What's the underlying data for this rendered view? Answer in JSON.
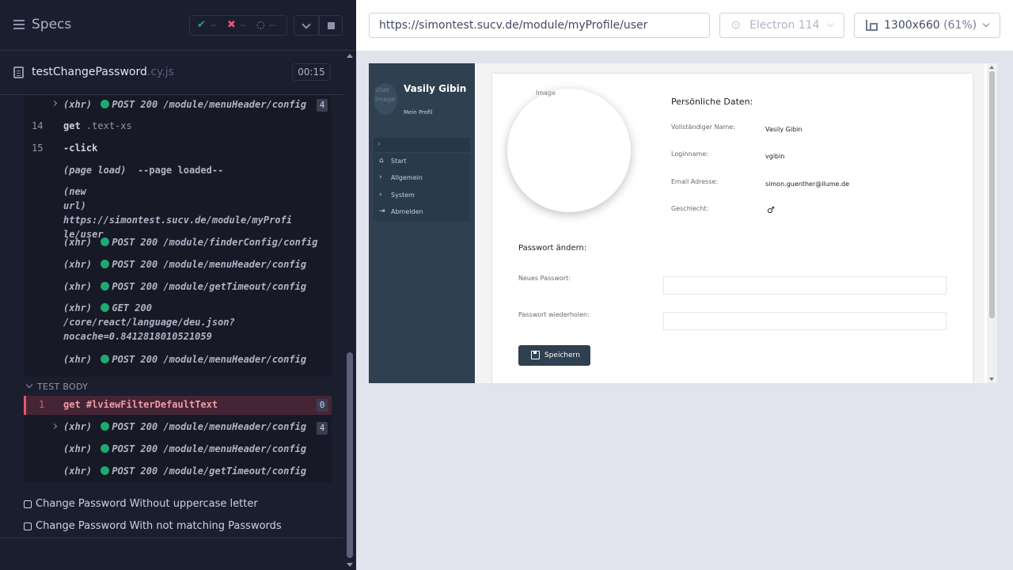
{
  "reporter": {
    "title": "Specs",
    "stats": {
      "passed": "--",
      "failed": "--",
      "pending": "--"
    },
    "file": {
      "name": "testChangePassword",
      "ext": ".cy.js",
      "duration": "00:15"
    },
    "commands": [
      {
        "type": "xhr",
        "label": "(xhr)",
        "method": "POST",
        "status": "200",
        "url": "/module/menuHeader/config",
        "count": "4"
      },
      {
        "num": "14",
        "name": "get",
        "arg": ".text-xs"
      },
      {
        "num": "15",
        "name": "-click"
      },
      {
        "label": "(page load)",
        "arg": "--page loaded--"
      },
      {
        "label": "(new url)",
        "lines": [
          "https://simontest.sucv.de/module/myProfi",
          "le/user"
        ]
      },
      {
        "type": "xhr",
        "label": "(xhr)",
        "method": "POST",
        "status": "200",
        "url": "/module/finderConfig/config"
      },
      {
        "type": "xhr",
        "label": "(xhr)",
        "method": "POST",
        "status": "200",
        "url": "/module/menuHeader/config"
      },
      {
        "type": "xhr",
        "label": "(xhr)",
        "method": "POST",
        "status": "200",
        "url": "/module/getTimeout/config"
      },
      {
        "type": "xhr",
        "label": "(xhr)",
        "method": "GET",
        "status": "200",
        "lines": [
          "/core/react/language/deu.json?",
          "nocache=0.8412818010521059"
        ]
      },
      {
        "type": "xhr",
        "label": "(xhr)",
        "method": "POST",
        "status": "200",
        "url": "/module/menuHeader/config"
      }
    ],
    "test_body_label": "TEST BODY",
    "failed_command": {
      "num": "1",
      "name": "get",
      "arg": "#lviewFilterDefaultText",
      "count": "0"
    },
    "body_commands": [
      {
        "label": "(xhr)",
        "method": "POST",
        "status": "200",
        "url": "/module/menuHeader/config",
        "count": "4"
      },
      {
        "label": "(xhr)",
        "method": "POST",
        "status": "200",
        "url": "/module/menuHeader/config"
      },
      {
        "label": "(xhr)",
        "method": "POST",
        "status": "200",
        "url": "/module/getTimeout/config"
      }
    ],
    "tests": [
      "Change Password Without uppercase letter",
      "Change Password With not matching Passwords"
    ]
  },
  "aut_header": {
    "url": "https://simontest.sucv.de/module/myProfile/user",
    "browser": "Electron 114",
    "viewport": "1300x660",
    "scale": "(61%)"
  },
  "app": {
    "user_image_alt": "User Image",
    "user_name": "Vasily Gibin",
    "user_sub": "Mein Profil",
    "nav": [
      {
        "icon": "home-icon",
        "glyph": "⌂",
        "label": "Start"
      },
      {
        "icon": "chevron-right-icon",
        "glyph": "›",
        "label": "Allgemein"
      },
      {
        "icon": "chevron-right-icon",
        "glyph": "›",
        "label": "System"
      },
      {
        "icon": "logout-icon",
        "glyph": "⇥",
        "label": "Abmelden"
      }
    ],
    "avatar_alt": "Image",
    "personal_title": "Persönliche Daten:",
    "fields": [
      {
        "label": "Vollständiger Name:",
        "value": "Vasily Gibin"
      },
      {
        "label": "Loginname:",
        "value": "vgibin"
      },
      {
        "label": "Email Adresse:",
        "value": "simon.guenther@ilume.de"
      },
      {
        "label": "Geschlecht:",
        "value": "♂"
      }
    ],
    "password_title": "Passwort ändern:",
    "new_password_label": "Neues Passwort:",
    "repeat_password_label": "Passwort wiederholen:",
    "save_label": "Speichern"
  }
}
